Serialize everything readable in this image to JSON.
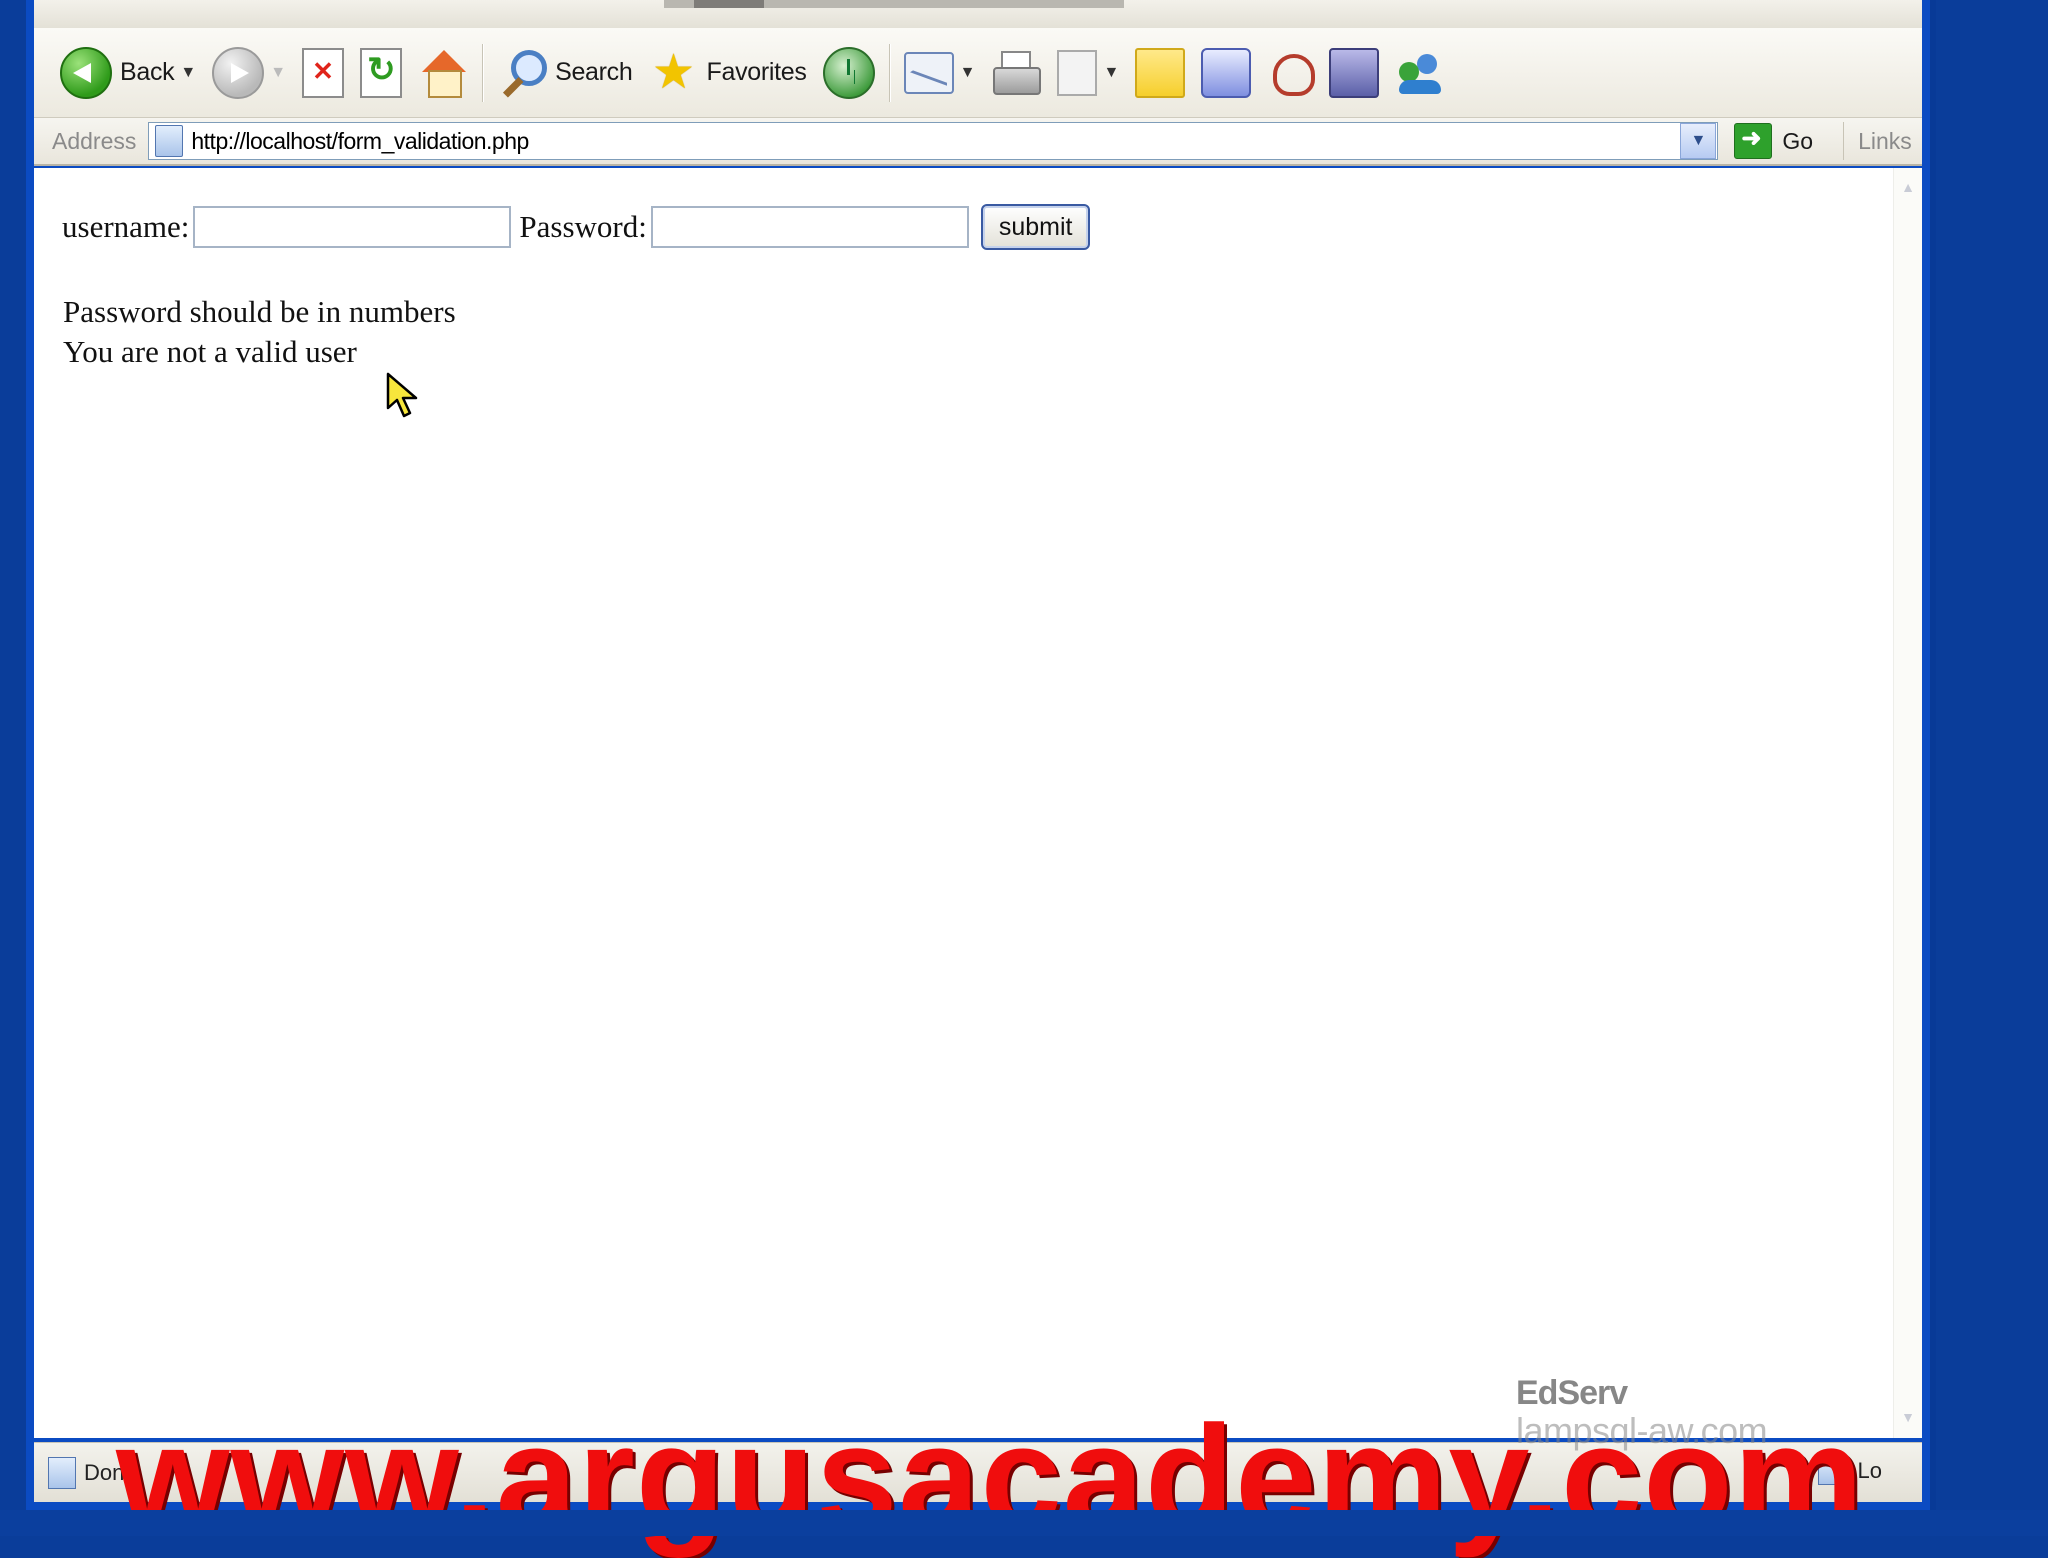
{
  "toolbar": {
    "back_label": "Back",
    "search_label": "Search",
    "favorites_label": "Favorites"
  },
  "address_bar": {
    "label": "Address",
    "url": "http://localhost/form_validation.php",
    "go_label": "Go",
    "links_label": "Links"
  },
  "form": {
    "username_label": "username:",
    "username_value": "",
    "password_label": "Password:",
    "password_value": "",
    "submit_label": "submit"
  },
  "messages": [
    "Password should be in numbers",
    "You are not a valid user"
  ],
  "status_bar": {
    "status_text": "Don",
    "zone_text": "Lo"
  },
  "watermarks": {
    "edserv": "EdServ",
    "lampsql": "lampsql-aw.com",
    "academy": "www.argusacademy.com"
  },
  "colors": {
    "window_frame": "#0b4bc2",
    "watermark_red": "#f00d0d",
    "go_green": "#2ea12c"
  }
}
